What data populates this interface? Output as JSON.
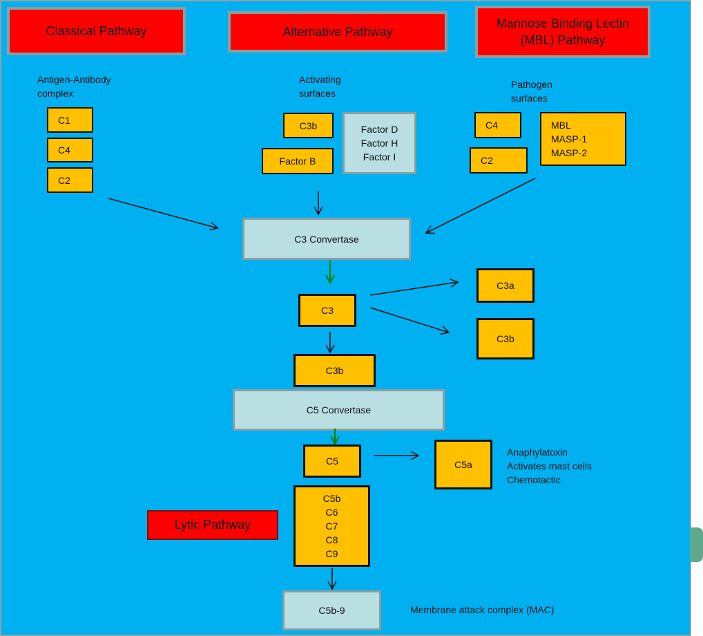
{
  "headers": {
    "classical": "Classical Pathway",
    "alternative": "Alternative Pathway",
    "mbl": "Mannose Binding Lectin (MBL) Pathway",
    "lytic": "Lytic Pathway"
  },
  "classical": {
    "label": "Antigen-Antibody\ncomplex",
    "items": [
      "C1",
      "C4",
      "C2"
    ]
  },
  "alternative": {
    "label": "Activating\nsurfaces",
    "c3b": "C3b",
    "factor_b": "Factor B",
    "factors": [
      "Factor D",
      "Factor H",
      "Factor I"
    ]
  },
  "mbl": {
    "label": "Pathogen\nsurfaces",
    "c4": "C4",
    "c2": "C2",
    "proteins": [
      "MBL",
      "MASP-1",
      "MASP-2"
    ]
  },
  "cascade": {
    "c3_convertase": "C3 Convertase",
    "c3": "C3",
    "c3a": "C3a",
    "c3b_right": "C3b",
    "c3b": "C3b",
    "c5_convertase": "C5 Convertase",
    "c5": "C5",
    "c5a": "C5a",
    "c5a_notes": "Anaphylatoxin\nActivates mast cells\nChemotactic",
    "lytic_items": [
      "C5b",
      "C6",
      "C7",
      "C8",
      "C9"
    ],
    "mac": "C5b-9",
    "mac_label": "Membrane  attack complex (MAC)"
  },
  "colors": {
    "background": "#00b0f0",
    "header": "#ff0000",
    "component": "#ffc000",
    "convertase": "#b9dfe3",
    "green_arrow": "#008000"
  }
}
